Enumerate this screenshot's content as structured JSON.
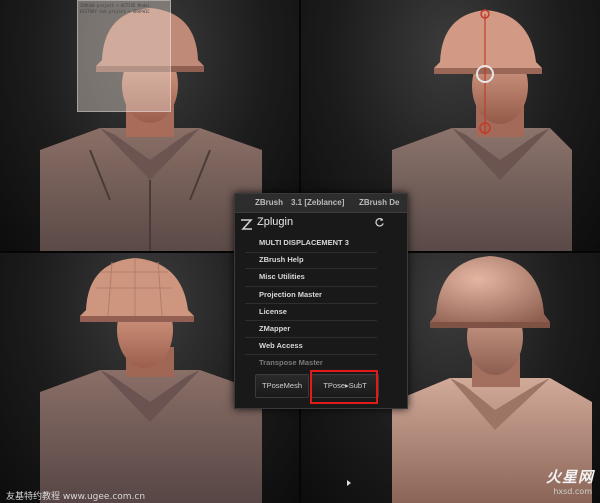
{
  "reference_overlay": {
    "caption_line1": "ZBRUSH project • ACTIVE Model",
    "caption_line2": "HISTORY tab project • GRAPHIC"
  },
  "zbrush_menu": {
    "topbar_items": [
      "ZBrush",
      "3.1 [Zeblance]",
      "ZBrush De"
    ],
    "title": "Zplugin",
    "items": [
      "MULTI DISPLACEMENT 3",
      "ZBrush Help",
      "Misc Utilities",
      "Projection Master",
      "License",
      "ZMapper",
      "Web Access",
      "Transpose Master"
    ],
    "buttons": {
      "tposemesh": "TPoseMesh",
      "tpose_subt": "TPose▸SubT"
    }
  },
  "highlight_color": "#e01b1b",
  "footer": {
    "credit": "友基特约教程  www.ugee.com.cn",
    "watermark": "火星网",
    "watermark_url": "hxsd.com"
  },
  "icons": [
    "zbrush-logo-icon",
    "refresh-icon",
    "cursor-icon"
  ]
}
